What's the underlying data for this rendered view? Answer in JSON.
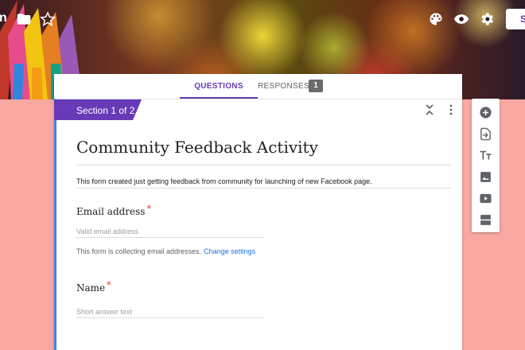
{
  "header": {
    "title_fragment": "n",
    "send_label": "SE",
    "icons": [
      "folder-icon",
      "star-icon",
      "palette-icon",
      "eye-icon",
      "gear-icon"
    ]
  },
  "tabs": {
    "questions_label": "QUESTIONS",
    "responses_label": "RESPONSES",
    "responses_count": "1"
  },
  "section": {
    "label": "Section 1 of 2"
  },
  "form": {
    "title": "Community Feedback Activity",
    "description": "This form created just getting feedback from community for launching of new Facebook page.",
    "questions": [
      {
        "label": "Email address",
        "required_mark": "*",
        "placeholder": "Valid email address"
      },
      {
        "label": "Name",
        "required_mark": "*",
        "placeholder": "Short answer text"
      }
    ],
    "collecting_note": "This form is collecting email addresses.",
    "change_settings_label": "Change settings"
  },
  "toolbar": {
    "icons": [
      "add-question-icon",
      "import-questions-icon",
      "add-title-icon",
      "add-image-icon",
      "add-video-icon",
      "add-section-icon"
    ]
  },
  "colors": {
    "accent": "#673ab7",
    "focus_border": "#4285f4",
    "background": "#f8a8a0",
    "link": "#1a73e8",
    "required": "#d93025"
  }
}
